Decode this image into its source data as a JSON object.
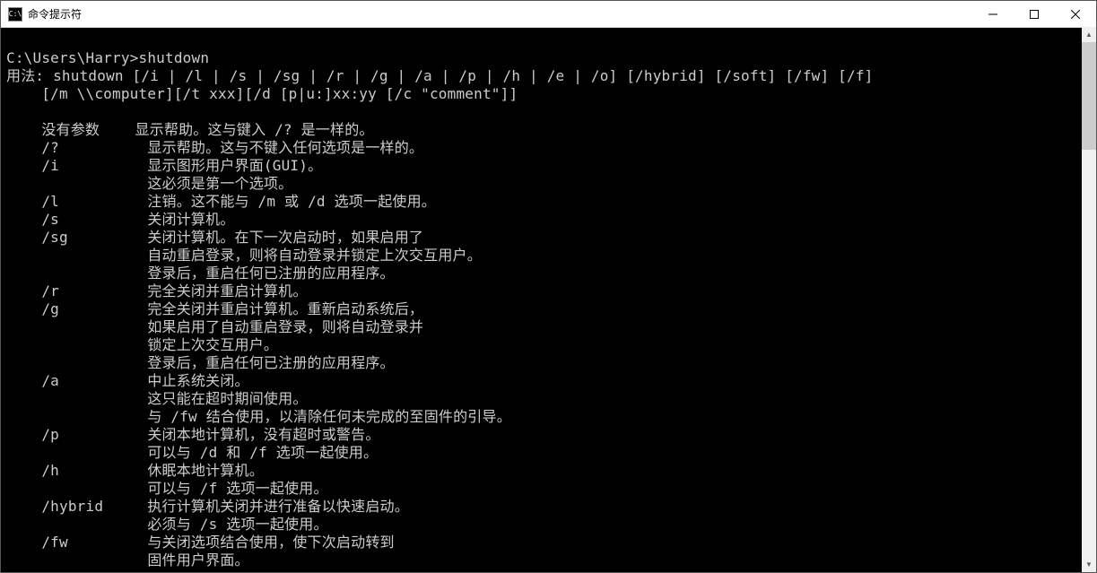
{
  "window": {
    "title": "命令提示符",
    "icon_label": "C:\\"
  },
  "terminal": {
    "lines": [
      "",
      "C:\\Users\\Harry>shutdown",
      "用法: shutdown [/i | /l | /s | /sg | /r | /g | /a | /p | /h | /e | /o] [/hybrid] [/soft] [/fw] [/f]",
      "    [/m \\\\computer][/t xxx][/d [p|u:]xx:yy [/c \"comment\"]]",
      "",
      "    没有参数    显示帮助。这与键入 /? 是一样的。",
      "    /?          显示帮助。这与不键入任何选项是一样的。",
      "    /i          显示图形用户界面(GUI)。",
      "                这必须是第一个选项。",
      "    /l          注销。这不能与 /m 或 /d 选项一起使用。",
      "    /s          关闭计算机。",
      "    /sg         关闭计算机。在下一次启动时，如果启用了",
      "                自动重启登录，则将自动登录并锁定上次交互用户。",
      "                登录后，重启任何已注册的应用程序。",
      "    /r          完全关闭并重启计算机。",
      "    /g          完全关闭并重启计算机。重新启动系统后，",
      "                如果启用了自动重启登录，则将自动登录并",
      "                锁定上次交互用户。",
      "                登录后，重启任何已注册的应用程序。",
      "    /a          中止系统关闭。",
      "                这只能在超时期间使用。",
      "                与 /fw 结合使用，以清除任何未完成的至固件的引导。",
      "    /p          关闭本地计算机，没有超时或警告。",
      "                可以与 /d 和 /f 选项一起使用。",
      "    /h          休眠本地计算机。",
      "                可以与 /f 选项一起使用。",
      "    /hybrid     执行计算机关闭并进行准备以快速启动。",
      "                必须与 /s 选项一起使用。",
      "    /fw         与关闭选项结合使用，使下次启动转到",
      "                固件用户界面。"
    ]
  }
}
